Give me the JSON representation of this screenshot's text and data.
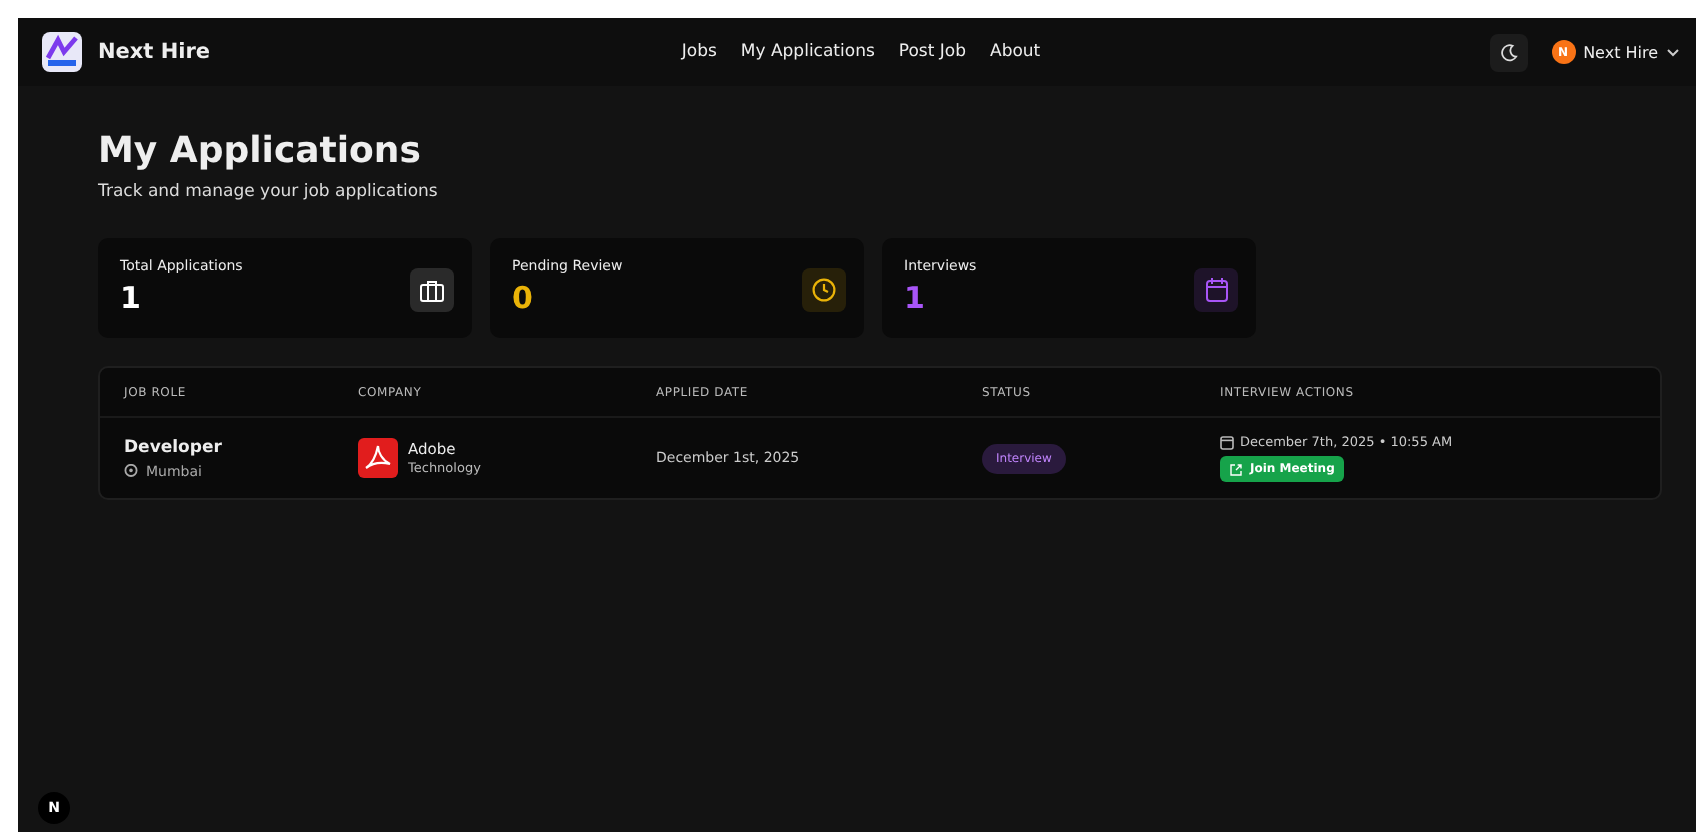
{
  "brand": {
    "name": "Next Hire"
  },
  "nav": [
    {
      "label": "Jobs"
    },
    {
      "label": "My Applications"
    },
    {
      "label": "Post Job"
    },
    {
      "label": "About"
    }
  ],
  "user": {
    "initial": "N",
    "name": "Next Hire"
  },
  "page": {
    "title": "My Applications",
    "subtitle": "Track and manage your job applications"
  },
  "stats": [
    {
      "label": "Total Applications",
      "value": "1",
      "kind": "briefcase",
      "color": "#ffffff"
    },
    {
      "label": "Pending Review",
      "value": "0",
      "kind": "clock",
      "color": "#eab308"
    },
    {
      "label": "Interviews",
      "value": "1",
      "kind": "calendar",
      "color": "#a855f7"
    }
  ],
  "table": {
    "columns": [
      "JOB ROLE",
      "COMPANY",
      "APPLIED DATE",
      "STATUS",
      "INTERVIEW ACTIONS"
    ],
    "rows": [
      {
        "role": "Developer",
        "location": "Mumbai",
        "company": "Adobe",
        "industry": "Technology",
        "applied": "December 1st, 2025",
        "status": {
          "label": "Interview",
          "kind": "interview"
        },
        "interview_time": "December 7th, 2025 • 10:55 AM",
        "action": "Join Meeting"
      }
    ]
  },
  "dev_badge": "N"
}
